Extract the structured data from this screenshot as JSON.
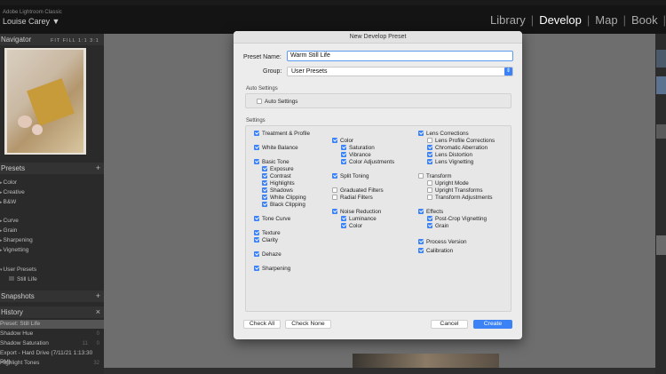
{
  "window": {
    "app_name": "Adobe Lightroom Classic",
    "user_name": "Louise Carey ▼",
    "modules": [
      "Library",
      "Develop",
      "Map",
      "Book"
    ],
    "active_module": "Develop"
  },
  "left_panel": {
    "navigator": {
      "title": "Navigator",
      "options": "FIT  FILL  1:1  3:1"
    },
    "presets": {
      "title": "Presets",
      "add": "+",
      "items": [
        "Color",
        "Creative",
        "B&W",
        "Curve",
        "Grain",
        "Sharpening",
        "Vignetting",
        "User Presets",
        "Still Life"
      ]
    },
    "snapshots": {
      "title": "Snapshots",
      "add": "+"
    },
    "history": {
      "title": "History",
      "close": "×",
      "items": [
        {
          "label": "Preset: Still Life",
          "a": "",
          "b": ""
        },
        {
          "label": "Shadow Hue",
          "a": "",
          "b": "0"
        },
        {
          "label": "Shadow Saturation",
          "a": "11",
          "b": "0"
        },
        {
          "label": "Export - Hard Drive (7/11/21 1:13:30 PM)",
          "a": "",
          "b": ""
        },
        {
          "label": "Highlight Tones",
          "a": "",
          "b": "32"
        }
      ]
    }
  },
  "dialog": {
    "title": "New Develop Preset",
    "preset_name_label": "Preset Name:",
    "preset_name_value": "Warm Still Life",
    "group_label": "Group:",
    "group_value": "User Presets",
    "auto_settings_section": "Auto Settings",
    "auto_settings_checkbox": "Auto Settings",
    "settings_section": "Settings",
    "col1": [
      {
        "label": "Treatment & Profile",
        "checked": true
      },
      {
        "label": "White Balance",
        "checked": true
      },
      {
        "label": "Basic Tone",
        "checked": true
      },
      {
        "label": "Exposure",
        "checked": true
      },
      {
        "label": "Contrast",
        "checked": true
      },
      {
        "label": "Highlights",
        "checked": true
      },
      {
        "label": "Shadows",
        "checked": true
      },
      {
        "label": "White Clipping",
        "checked": true
      },
      {
        "label": "Black Clipping",
        "checked": true
      },
      {
        "label": "Tone Curve",
        "checked": true
      },
      {
        "label": "Texture",
        "checked": true
      },
      {
        "label": "Clarity",
        "checked": true
      },
      {
        "label": "Dehaze",
        "checked": true
      },
      {
        "label": "Sharpening",
        "checked": true
      }
    ],
    "col2": [
      {
        "label": "Color",
        "checked": true
      },
      {
        "label": "Saturation",
        "checked": true
      },
      {
        "label": "Vibrance",
        "checked": true
      },
      {
        "label": "Color Adjustments",
        "checked": true
      },
      {
        "label": "Split Toning",
        "checked": true
      },
      {
        "label": "Graduated Filters",
        "checked": false
      },
      {
        "label": "Radial Filters",
        "checked": false
      },
      {
        "label": "Noise Reduction",
        "checked": true
      },
      {
        "label": "Luminance",
        "checked": true
      },
      {
        "label": "Color",
        "checked": true
      }
    ],
    "col3": [
      {
        "label": "Lens Corrections",
        "checked": true
      },
      {
        "label": "Lens Profile Corrections",
        "checked": false
      },
      {
        "label": "Chromatic Aberration",
        "checked": true
      },
      {
        "label": "Lens Distortion",
        "checked": true
      },
      {
        "label": "Lens Vignetting",
        "checked": true
      },
      {
        "label": "Transform",
        "checked": false
      },
      {
        "label": "Upright Mode",
        "checked": false
      },
      {
        "label": "Upright Transforms",
        "checked": false
      },
      {
        "label": "Transform Adjustments",
        "checked": false
      },
      {
        "label": "Effects",
        "checked": true
      },
      {
        "label": "Post-Crop Vignetting",
        "checked": true
      },
      {
        "label": "Grain",
        "checked": true
      },
      {
        "label": "Process Version",
        "checked": true
      },
      {
        "label": "Calibration",
        "checked": true
      }
    ],
    "buttons": {
      "check_all": "Check All",
      "check_none": "Check None",
      "cancel": "Cancel",
      "create": "Create"
    },
    "accent_color": "#3b82f6"
  }
}
